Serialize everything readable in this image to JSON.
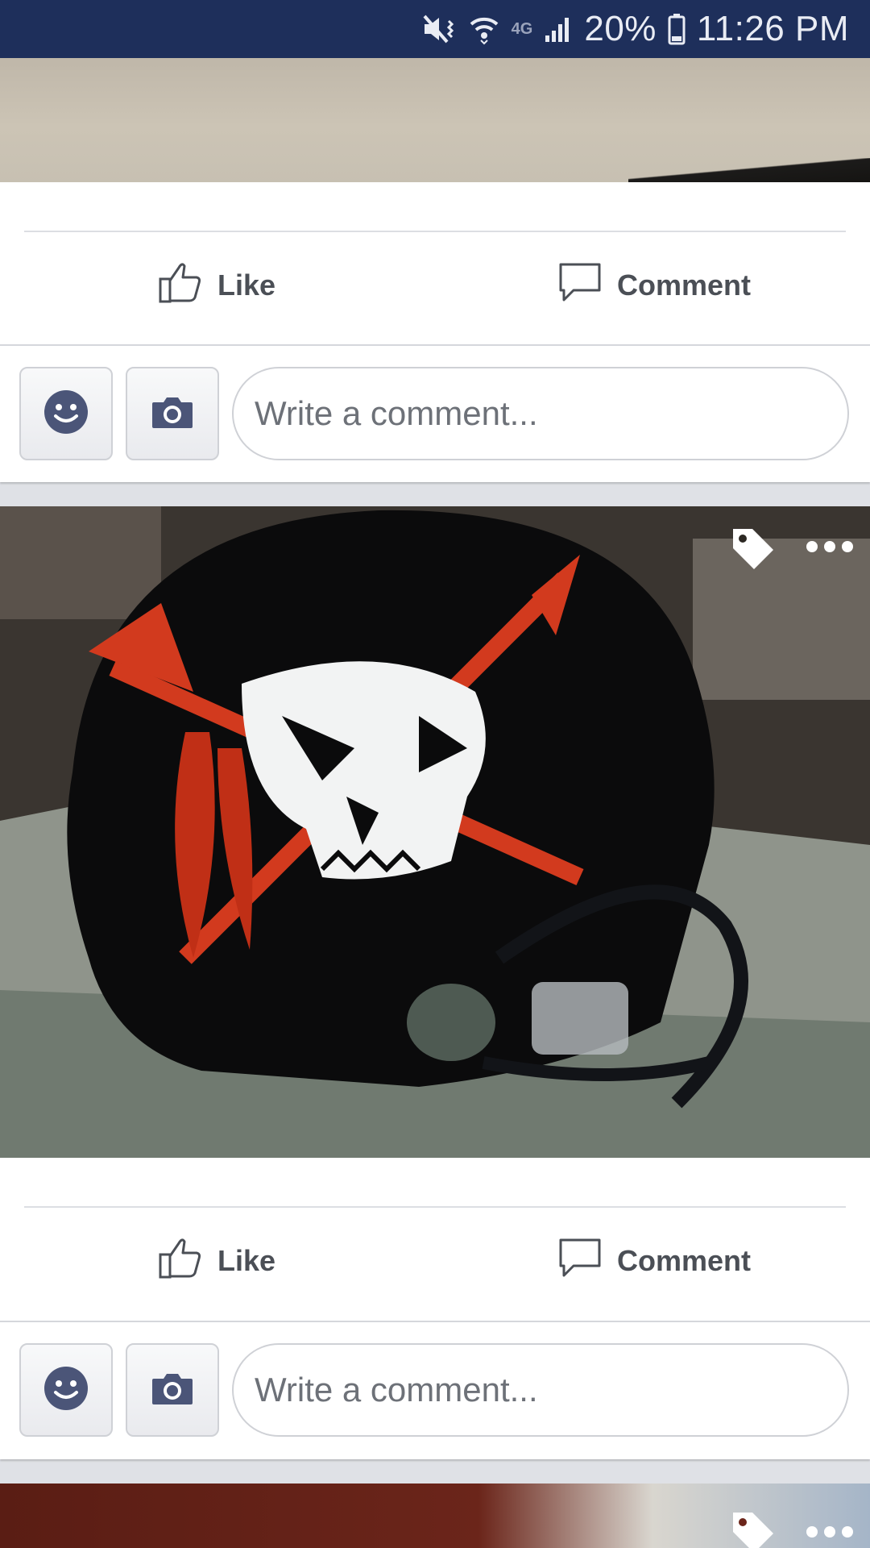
{
  "status_bar": {
    "battery": "20%",
    "time": "11:26 PM",
    "network": "4G",
    "icons": [
      "mute-vibrate-icon",
      "wifi-icon",
      "lte-icon",
      "signal-icon",
      "battery-icon"
    ]
  },
  "posts": [
    {
      "like_label": "Like",
      "comment_label": "Comment",
      "comment_placeholder": "Write a comment..."
    },
    {
      "like_label": "Like",
      "comment_label": "Comment",
      "comment_placeholder": "Write a comment..."
    }
  ],
  "colors": {
    "status_bar_bg": "#1e2f5b",
    "action_text": "#4b4f56",
    "icon_dark": "#4b5578"
  }
}
